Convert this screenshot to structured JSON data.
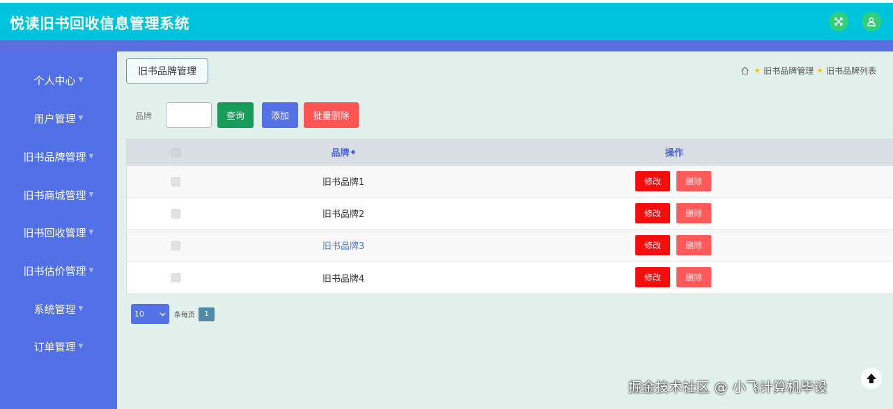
{
  "app": {
    "title": "悦读旧书回收信息管理系统"
  },
  "header_icons": [
    "fullscreen-icon",
    "user-icon"
  ],
  "sidebar": {
    "items": [
      {
        "label": "个人中心"
      },
      {
        "label": "用户管理"
      },
      {
        "label": "旧书品牌管理"
      },
      {
        "label": "旧书商城管理"
      },
      {
        "label": "旧书回收管理"
      },
      {
        "label": "旧书估价管理"
      },
      {
        "label": "系统管理"
      },
      {
        "label": "订单管理"
      }
    ]
  },
  "page": {
    "title": "旧书品牌管理",
    "breadcrumb": [
      "旧书品牌管理",
      "旧书品牌列表"
    ]
  },
  "search": {
    "label": "品牌",
    "value": "",
    "query_label": "查询",
    "add_label": "添加",
    "batch_delete_label": "批量删除"
  },
  "table": {
    "columns": {
      "brand": "品牌",
      "ops": "操作"
    },
    "rows": [
      {
        "brand": "旧书品牌1",
        "edit": "修改",
        "delete": "删除"
      },
      {
        "brand": "旧书品牌2",
        "edit": "修改",
        "delete": "删除"
      },
      {
        "brand": "旧书品牌3",
        "edit": "修改",
        "delete": "删除"
      },
      {
        "brand": "旧书品牌4",
        "edit": "修改",
        "delete": "删除"
      }
    ]
  },
  "pagination": {
    "page_size": "10",
    "per_page_label": "条每页",
    "current_page": "1"
  },
  "watermark": "掘金技术社区 @ 小飞计算机毕设",
  "colors": {
    "topbar": "#00c4dc",
    "sidebar": "#5270e6",
    "content_bg": "#e3f1ec",
    "query_button": "#199b5a",
    "add_button": "#5573e6",
    "danger": "#ff5454"
  }
}
